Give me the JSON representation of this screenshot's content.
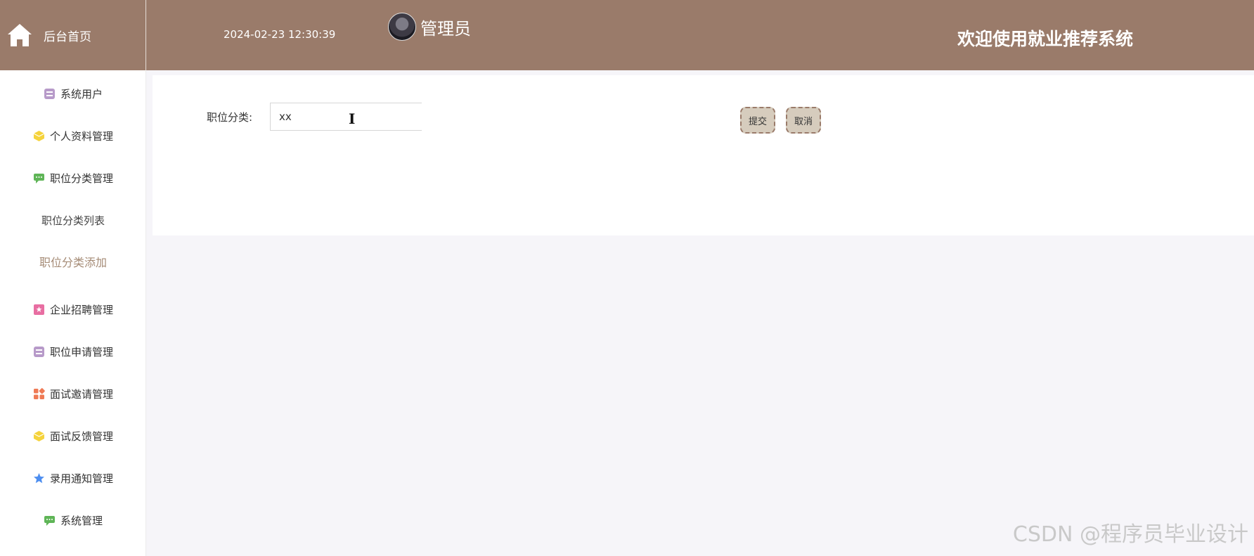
{
  "header": {
    "home_label": "后台首页",
    "datetime": "2024-02-23 12:30:39",
    "user_name": "管理员",
    "welcome": "欢迎使用就业推荐系统"
  },
  "sidebar": {
    "items": [
      {
        "label": "系统用户",
        "icon": "archive-icon",
        "color": "#b79ac9"
      },
      {
        "label": "个人资料管理",
        "icon": "cube-icon",
        "color": "#f5d33c"
      },
      {
        "label": "职位分类管理",
        "icon": "chat-icon",
        "color": "#5fb557"
      },
      {
        "label": "职位分类列表",
        "icon": null,
        "active": false
      },
      {
        "label": "职位分类添加",
        "icon": null,
        "active": true
      },
      {
        "label": "企业招聘管理",
        "icon": "document-icon",
        "color": "#e86ea2"
      },
      {
        "label": "职位申请管理",
        "icon": "archive-icon",
        "color": "#b79ac9"
      },
      {
        "label": "面试邀请管理",
        "icon": "grid-icon",
        "color": "#ef7a55"
      },
      {
        "label": "面试反馈管理",
        "icon": "cube-icon",
        "color": "#f5d33c"
      },
      {
        "label": "录用通知管理",
        "icon": "star-icon",
        "color": "#4d8ef0"
      },
      {
        "label": "系统管理",
        "icon": "chat-icon",
        "color": "#5fb557"
      }
    ]
  },
  "form": {
    "category_label": "职位分类:",
    "category_value": "xx",
    "submit_label": "提交",
    "cancel_label": "取消"
  },
  "watermark": "CSDN @程序员毕业设计"
}
